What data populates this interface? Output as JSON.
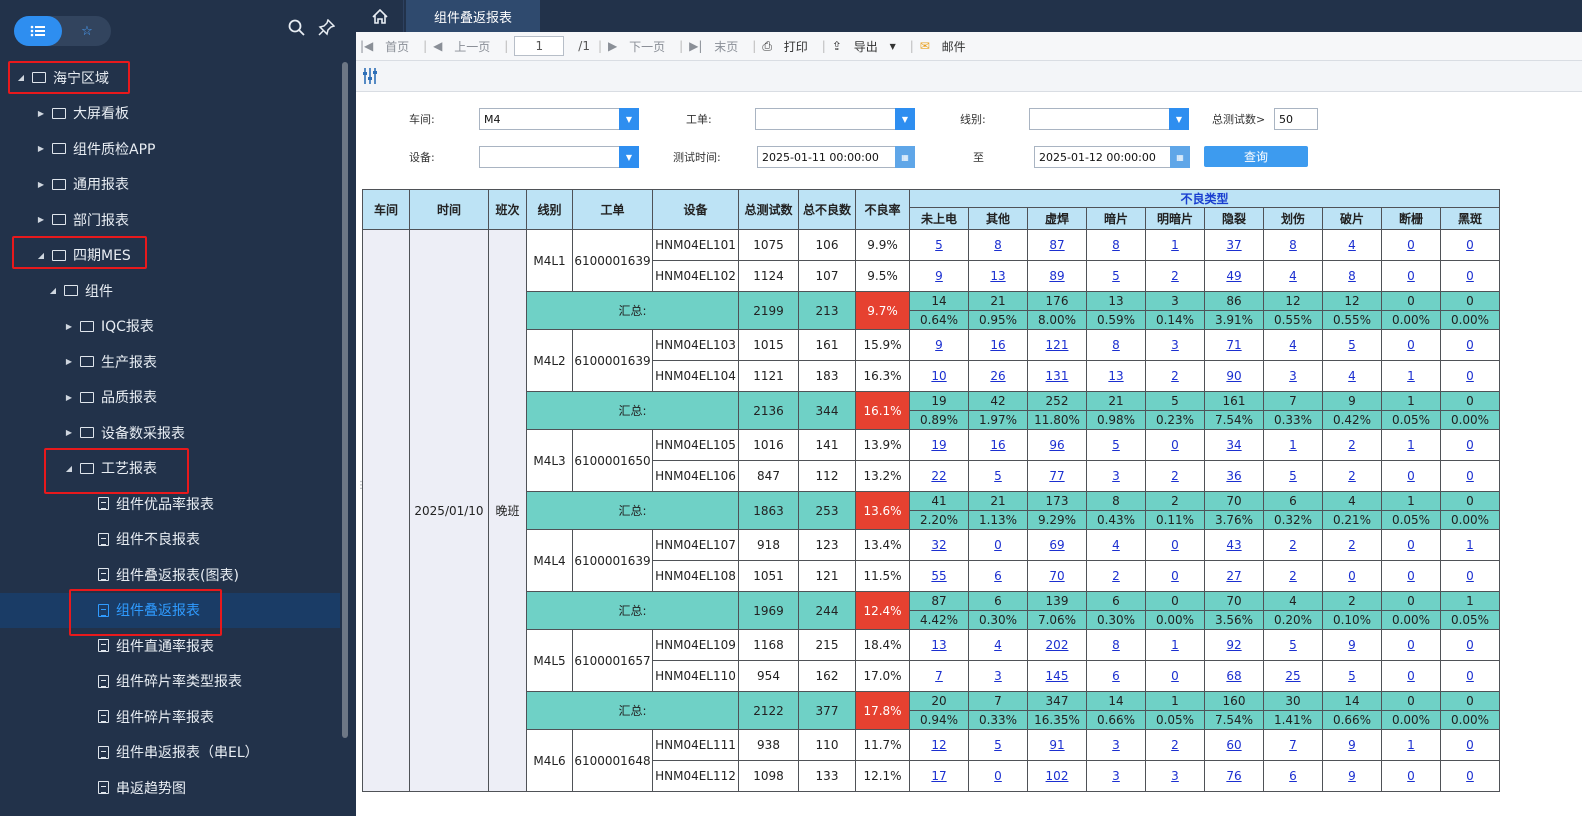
{
  "sidebar": {
    "items": [
      {
        "label": "海宁区域",
        "level": 0,
        "expanded": true,
        "icon": "folder-icon"
      },
      {
        "label": "大屏看板",
        "level": 1,
        "expanded": false,
        "icon": "board-icon"
      },
      {
        "label": "组件质检APP",
        "level": 1,
        "expanded": false,
        "icon": "folder-icon"
      },
      {
        "label": "通用报表",
        "level": 1,
        "expanded": false,
        "icon": "report-icon"
      },
      {
        "label": "部门报表",
        "level": 1,
        "expanded": false,
        "icon": "group-icon"
      },
      {
        "label": "四期MES",
        "level": 1,
        "expanded": true,
        "icon": "folder-icon"
      },
      {
        "label": "组件",
        "level": 2,
        "expanded": true,
        "icon": "folder-icon"
      },
      {
        "label": "IQC报表",
        "level": 3,
        "expanded": false,
        "icon": "folder-icon"
      },
      {
        "label": "生产报表",
        "level": 3,
        "expanded": false,
        "icon": "folder-icon"
      },
      {
        "label": "品质报表",
        "level": 3,
        "expanded": false,
        "icon": "folder-icon"
      },
      {
        "label": "设备数采报表",
        "level": 3,
        "expanded": false,
        "icon": "folder-icon"
      },
      {
        "label": "工艺报表",
        "level": 3,
        "expanded": true,
        "icon": "folder-icon"
      },
      {
        "label": "组件优品率报表",
        "level": 4,
        "icon": "doc-icon"
      },
      {
        "label": "组件不良报表",
        "level": 4,
        "icon": "doc-icon"
      },
      {
        "label": "组件叠返报表(图表)",
        "level": 4,
        "icon": "doc-icon"
      },
      {
        "label": "组件叠返报表",
        "level": 4,
        "icon": "doc-icon",
        "selected": true
      },
      {
        "label": "组件直通率报表",
        "level": 4,
        "icon": "doc-icon"
      },
      {
        "label": "组件碎片率类型报表",
        "level": 4,
        "icon": "doc-icon"
      },
      {
        "label": "组件碎片率报表",
        "level": 4,
        "icon": "doc-icon"
      },
      {
        "label": "组件串返报表（串EL）",
        "level": 4,
        "icon": "doc-icon"
      },
      {
        "label": "串返趋势图",
        "level": 4,
        "icon": "doc-icon"
      }
    ]
  },
  "tabs": {
    "active": "组件叠返报表"
  },
  "pager": {
    "first": "首页",
    "prev": "上一页",
    "page": "1",
    "total": "/1",
    "next": "下一页",
    "last": "末页",
    "print": "打印",
    "export": "导出",
    "mail": "邮件"
  },
  "filters": {
    "workshop_label": "车间:",
    "workshop_value": "M4",
    "order_label": "工单:",
    "order_value": "",
    "line_label": "线别:",
    "line_value": "",
    "count_label": "总测试数>",
    "count_value": "50",
    "device_label": "设备:",
    "device_value": "",
    "time_label": "测试时间:",
    "time_from": "2025-01-11 00:00:00",
    "to_label": "至",
    "time_to": "2025-01-12 00:00:00",
    "query": "查询"
  },
  "table": {
    "headers": [
      "车间",
      "时间",
      "班次",
      "线别",
      "工单",
      "设备",
      "总测试数",
      "总不良数",
      "不良率"
    ],
    "group_header": "不良类型",
    "defect_types": [
      "未上电",
      "其他",
      "虚焊",
      "暗片",
      "明暗片",
      "隐裂",
      "划伤",
      "破片",
      "断栅",
      "黑斑"
    ],
    "date": "2025/01/10",
    "shift": "晚班",
    "sum_label": "汇总:",
    "groups": [
      {
        "line": "M4L1",
        "order": "6100001639",
        "rows": [
          {
            "device": "HNM04EL101",
            "total": "1075",
            "bad": "106",
            "rate": "9.9%",
            "d": [
              "5",
              "8",
              "87",
              "8",
              "1",
              "37",
              "8",
              "4",
              "0",
              "0"
            ]
          },
          {
            "device": "HNM04EL102",
            "total": "1124",
            "bad": "107",
            "rate": "9.5%",
            "d": [
              "9",
              "13",
              "89",
              "5",
              "2",
              "49",
              "4",
              "8",
              "0",
              "0"
            ]
          }
        ],
        "sum": {
          "total": "2199",
          "bad": "213",
          "rate": "9.7%",
          "counts": [
            "14",
            "21",
            "176",
            "13",
            "3",
            "86",
            "12",
            "12",
            "0",
            "0"
          ],
          "pcts": [
            "0.64%",
            "0.95%",
            "8.00%",
            "0.59%",
            "0.14%",
            "3.91%",
            "0.55%",
            "0.55%",
            "0.00%",
            "0.00%"
          ]
        }
      },
      {
        "line": "M4L2",
        "order": "6100001639",
        "rows": [
          {
            "device": "HNM04EL103",
            "total": "1015",
            "bad": "161",
            "rate": "15.9%",
            "d": [
              "9",
              "16",
              "121",
              "8",
              "3",
              "71",
              "4",
              "5",
              "0",
              "0"
            ]
          },
          {
            "device": "HNM04EL104",
            "total": "1121",
            "bad": "183",
            "rate": "16.3%",
            "d": [
              "10",
              "26",
              "131",
              "13",
              "2",
              "90",
              "3",
              "4",
              "1",
              "0"
            ]
          }
        ],
        "sum": {
          "total": "2136",
          "bad": "344",
          "rate": "16.1%",
          "counts": [
            "19",
            "42",
            "252",
            "21",
            "5",
            "161",
            "7",
            "9",
            "1",
            "0"
          ],
          "pcts": [
            "0.89%",
            "1.97%",
            "11.80%",
            "0.98%",
            "0.23%",
            "7.54%",
            "0.33%",
            "0.42%",
            "0.05%",
            "0.00%"
          ]
        }
      },
      {
        "line": "M4L3",
        "order": "6100001650",
        "rows": [
          {
            "device": "HNM04EL105",
            "total": "1016",
            "bad": "141",
            "rate": "13.9%",
            "d": [
              "19",
              "16",
              "96",
              "5",
              "0",
              "34",
              "1",
              "2",
              "1",
              "0"
            ]
          },
          {
            "device": "HNM04EL106",
            "total": "847",
            "bad": "112",
            "rate": "13.2%",
            "d": [
              "22",
              "5",
              "77",
              "3",
              "2",
              "36",
              "5",
              "2",
              "0",
              "0"
            ]
          }
        ],
        "sum": {
          "total": "1863",
          "bad": "253",
          "rate": "13.6%",
          "counts": [
            "41",
            "21",
            "173",
            "8",
            "2",
            "70",
            "6",
            "4",
            "1",
            "0"
          ],
          "pcts": [
            "2.20%",
            "1.13%",
            "9.29%",
            "0.43%",
            "0.11%",
            "3.76%",
            "0.32%",
            "0.21%",
            "0.05%",
            "0.00%"
          ]
        }
      },
      {
        "line": "M4L4",
        "order": "6100001639",
        "rows": [
          {
            "device": "HNM04EL107",
            "total": "918",
            "bad": "123",
            "rate": "13.4%",
            "d": [
              "32",
              "0",
              "69",
              "4",
              "0",
              "43",
              "2",
              "2",
              "0",
              "1"
            ]
          },
          {
            "device": "HNM04EL108",
            "total": "1051",
            "bad": "121",
            "rate": "11.5%",
            "d": [
              "55",
              "6",
              "70",
              "2",
              "0",
              "27",
              "2",
              "0",
              "0",
              "0"
            ]
          }
        ],
        "sum": {
          "total": "1969",
          "bad": "244",
          "rate": "12.4%",
          "counts": [
            "87",
            "6",
            "139",
            "6",
            "0",
            "70",
            "4",
            "2",
            "0",
            "1"
          ],
          "pcts": [
            "4.42%",
            "0.30%",
            "7.06%",
            "0.30%",
            "0.00%",
            "3.56%",
            "0.20%",
            "0.10%",
            "0.00%",
            "0.05%"
          ]
        }
      },
      {
        "line": "M4L5",
        "order": "6100001657",
        "rows": [
          {
            "device": "HNM04EL109",
            "total": "1168",
            "bad": "215",
            "rate": "18.4%",
            "d": [
              "13",
              "4",
              "202",
              "8",
              "1",
              "92",
              "5",
              "9",
              "0",
              "0"
            ]
          },
          {
            "device": "HNM04EL110",
            "total": "954",
            "bad": "162",
            "rate": "17.0%",
            "d": [
              "7",
              "3",
              "145",
              "6",
              "0",
              "68",
              "25",
              "5",
              "0",
              "0"
            ]
          }
        ],
        "sum": {
          "total": "2122",
          "bad": "377",
          "rate": "17.8%",
          "counts": [
            "20",
            "7",
            "347",
            "14",
            "1",
            "160",
            "30",
            "14",
            "0",
            "0"
          ],
          "pcts": [
            "0.94%",
            "0.33%",
            "16.35%",
            "0.66%",
            "0.05%",
            "7.54%",
            "1.41%",
            "0.66%",
            "0.00%",
            "0.00%"
          ]
        }
      },
      {
        "line": "M4L6",
        "order": "6100001648",
        "rows": [
          {
            "device": "HNM04EL111",
            "total": "938",
            "bad": "110",
            "rate": "11.7%",
            "d": [
              "12",
              "5",
              "91",
              "3",
              "2",
              "60",
              "7",
              "9",
              "1",
              "0"
            ]
          },
          {
            "device": "HNM04EL112",
            "total": "1098",
            "bad": "133",
            "rate": "12.1%",
            "d": [
              "17",
              "0",
              "102",
              "3",
              "3",
              "76",
              "6",
              "9",
              "0",
              "0"
            ]
          }
        ]
      }
    ]
  },
  "colors": {
    "sidebar_bg": "#22324a",
    "accent": "#2e8ef0",
    "header_bg": "#bde3f5",
    "sum_bg": "#6fd1c6",
    "rate_red": "#e64130",
    "highlight": "#e8191c"
  }
}
